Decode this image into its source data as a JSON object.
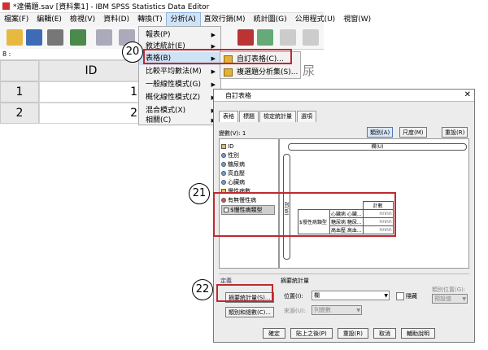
{
  "window": {
    "title": "*達備題.sav [資料集1] - IBM SPSS Statistics Data Editor"
  },
  "menubar": [
    {
      "label": "檔案(F)"
    },
    {
      "label": "編輯(E)"
    },
    {
      "label": "檢視(V)"
    },
    {
      "label": "資料(D)"
    },
    {
      "label": "轉換(T)"
    },
    {
      "label": "分析(A)"
    },
    {
      "label": "直效行銷(M)"
    },
    {
      "label": "統計圖(G)"
    },
    {
      "label": "公用程式(U)"
    },
    {
      "label": "視窗(W)"
    }
  ],
  "cell_ref": "8 :",
  "grid": {
    "column": "ID",
    "rows": [
      {
        "n": "1",
        "v": "1"
      },
      {
        "n": "2",
        "v": "2"
      }
    ]
  },
  "analyze_menu": [
    {
      "label": "報表(P)"
    },
    {
      "label": "敘述統計(E)"
    },
    {
      "label": "表格(B)"
    },
    {
      "label": "比較平均數法(M)"
    },
    {
      "label": "一般線性模式(G)"
    },
    {
      "label": "概化線性模式(Z)"
    },
    {
      "label": "混合模式(X)"
    },
    {
      "label": "相關(C)"
    }
  ],
  "tables_submenu": [
    {
      "label": "自訂表格(C)..."
    },
    {
      "label": "複選題分析集(S)..."
    }
  ],
  "bg_text": "尿",
  "callouts": [
    "20",
    "21",
    "22"
  ],
  "dialog": {
    "title": "自訂表格",
    "close": "✕",
    "tabs": [
      "表格",
      "標題",
      "檢定統計量",
      "選項"
    ],
    "vars_label": "變數(V):",
    "vars_count": "1",
    "btn_category": "類別(A)",
    "btn_scale": "尺度(M)",
    "btn_reset": "重設(R)",
    "variables": [
      {
        "label": "ID"
      },
      {
        "label": "性別"
      },
      {
        "label": "糖尿病"
      },
      {
        "label": "高血壓"
      },
      {
        "label": "心臟病"
      },
      {
        "label": "慢性病數"
      },
      {
        "label": "有無慢性病"
      },
      {
        "label": "$慢性病類型"
      }
    ],
    "col_label": "欄(U)",
    "row_label": "列(W)",
    "table": {
      "header": "計數",
      "row_group": "$慢性病類型",
      "rows": [
        {
          "name": "心臟病 心臟...",
          "val": "nnnn"
        },
        {
          "name": "糖尿病 糖尿...",
          "val": "nnnn"
        },
        {
          "name": "高血壓 高血...",
          "val": "nnnn"
        }
      ]
    },
    "defines_label": "定義",
    "btn_summary": "摘要統計量(S)...",
    "btn_category_total": "類別和總數(C)...",
    "summary_label": "摘要統計量",
    "position_label": "位置(I):",
    "position_value": "欄",
    "hide_label": "隱藏",
    "source_label": "來源(U):",
    "source_value": "列變數",
    "cat_pos_label": "類別位置(G):",
    "cat_pos_value": "預設值",
    "buttons": [
      "確定",
      "貼上之後(P)",
      "重設(R)",
      "取消",
      "輔助說明"
    ]
  }
}
